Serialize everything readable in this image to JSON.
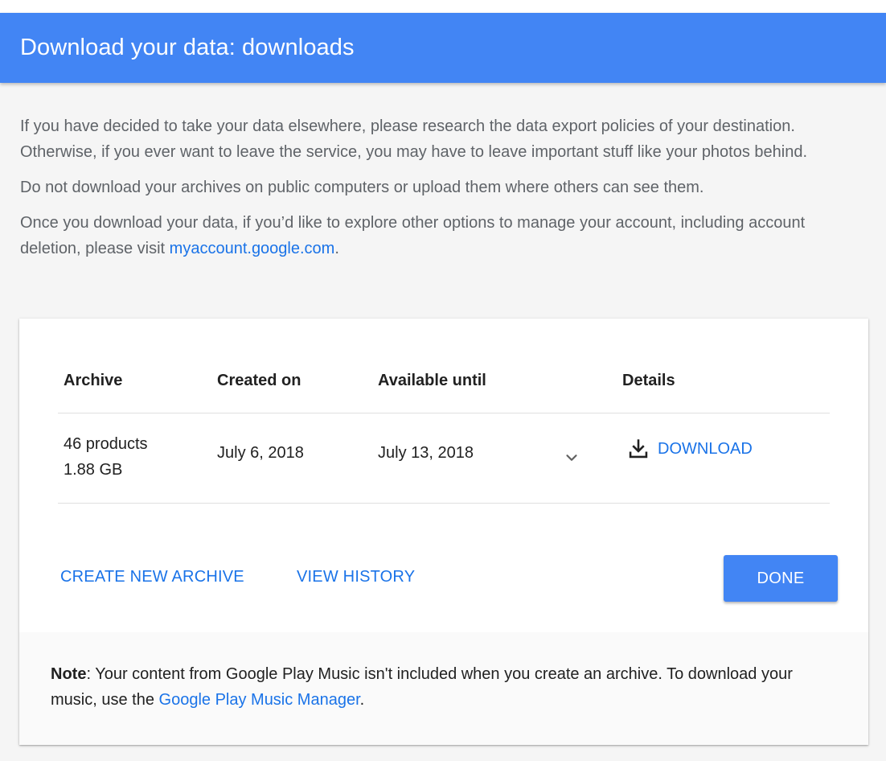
{
  "header": {
    "title": "Download your data: downloads"
  },
  "intro": {
    "p1": "If you have decided to take your data elsewhere, please research the data export policies of your destination. Otherwise, if you ever want to leave the service, you may have to leave important stuff like your photos behind.",
    "p2": "Do not download your archives on public computers or upload them where others can see them.",
    "p3_before": "Once you download your data, if you’d like to explore other options to manage your account, including account deletion, please visit ",
    "p3_link": "myaccount.google.com",
    "p3_after": "."
  },
  "table": {
    "columns": [
      "Archive",
      "Created on",
      "Available until",
      "Details"
    ],
    "rows": [
      {
        "archive_title": "46 products",
        "archive_size": "1.88 GB",
        "created_on": "July 6, 2018",
        "available_until": "July 13, 2018",
        "download_label": "DOWNLOAD"
      }
    ]
  },
  "actions": {
    "create_label": "CREATE NEW ARCHIVE",
    "history_label": "VIEW HISTORY",
    "done_label": "DONE"
  },
  "note": {
    "label": "Note",
    "text_before": ": Your content from Google Play Music isn't included when you create an archive. To download your music, use the ",
    "link": "Google Play Music Manager",
    "text_after": "."
  },
  "icons": {
    "download": "download-icon",
    "expand": "chevron-down-icon"
  },
  "colors": {
    "header": "#4285f4",
    "link": "#1a73e8",
    "primary_button": "#4285f4"
  }
}
